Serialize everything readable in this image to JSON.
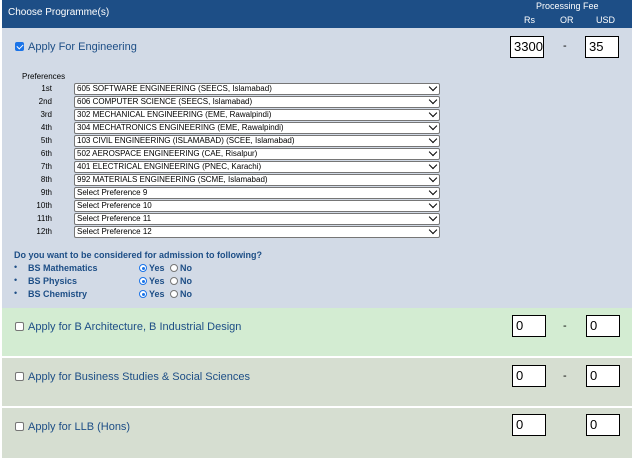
{
  "header": {
    "title": "Choose Programme(s)",
    "processing_fee": "Processing Fee",
    "rs": "Rs",
    "or": "OR",
    "usd": "USD"
  },
  "engineering": {
    "label": "Apply For Engineering",
    "checked": true,
    "fee_rs": "3300",
    "fee_usd": "35",
    "dash": "-",
    "preferences_label": "Preferences",
    "preferences": [
      {
        "ordinal": "1st",
        "value": "605 SOFTWARE ENGINEERING (SEECS, Islamabad)"
      },
      {
        "ordinal": "2nd",
        "value": "606 COMPUTER SCIENCE (SEECS, Islamabad)"
      },
      {
        "ordinal": "3rd",
        "value": "302 MECHANICAL ENGINEERING (EME, Rawalpindi)"
      },
      {
        "ordinal": "4th",
        "value": "304 MECHATRONICS ENGINEERING (EME, Rawalpindi)"
      },
      {
        "ordinal": "5th",
        "value": "103 CIVIL ENGINEERING (ISLAMABAD) (SCEE, Islamabad)"
      },
      {
        "ordinal": "6th",
        "value": "502 AEROSPACE ENGINEERING (CAE, Risalpur)"
      },
      {
        "ordinal": "7th",
        "value": "401 ELECTRICAL ENGINEERING (PNEC, Karachi)"
      },
      {
        "ordinal": "8th",
        "value": "992 MATERIALS ENGINEERING (SCME, Islamabad)"
      },
      {
        "ordinal": "9th",
        "value": "Select Preference 9"
      },
      {
        "ordinal": "10th",
        "value": "Select Preference 10"
      },
      {
        "ordinal": "11th",
        "value": "Select Preference 11"
      },
      {
        "ordinal": "12th",
        "value": "Select Preference 12"
      }
    ],
    "question": "Do you want to be considered for admission to following?",
    "bullet": "•",
    "yes_label": "Yes",
    "no_label": "No",
    "bs_options": [
      {
        "name": "BS Mathematics",
        "selected": "Yes"
      },
      {
        "name": "BS Physics",
        "selected": "Yes"
      },
      {
        "name": "BS Chemistry",
        "selected": "Yes"
      }
    ]
  },
  "architecture": {
    "label": "Apply for B Architecture, B Industrial Design",
    "checked": false,
    "fee_rs": "0",
    "fee_usd": "0",
    "dash": "-"
  },
  "business": {
    "label": "Apply for Business Studies & Social Sciences",
    "checked": false,
    "fee_rs": "0",
    "fee_usd": "0",
    "dash": "-"
  },
  "llb": {
    "label": "Apply for LLB (Hons)",
    "checked": false,
    "fee_rs": "0",
    "fee_usd": "0"
  }
}
